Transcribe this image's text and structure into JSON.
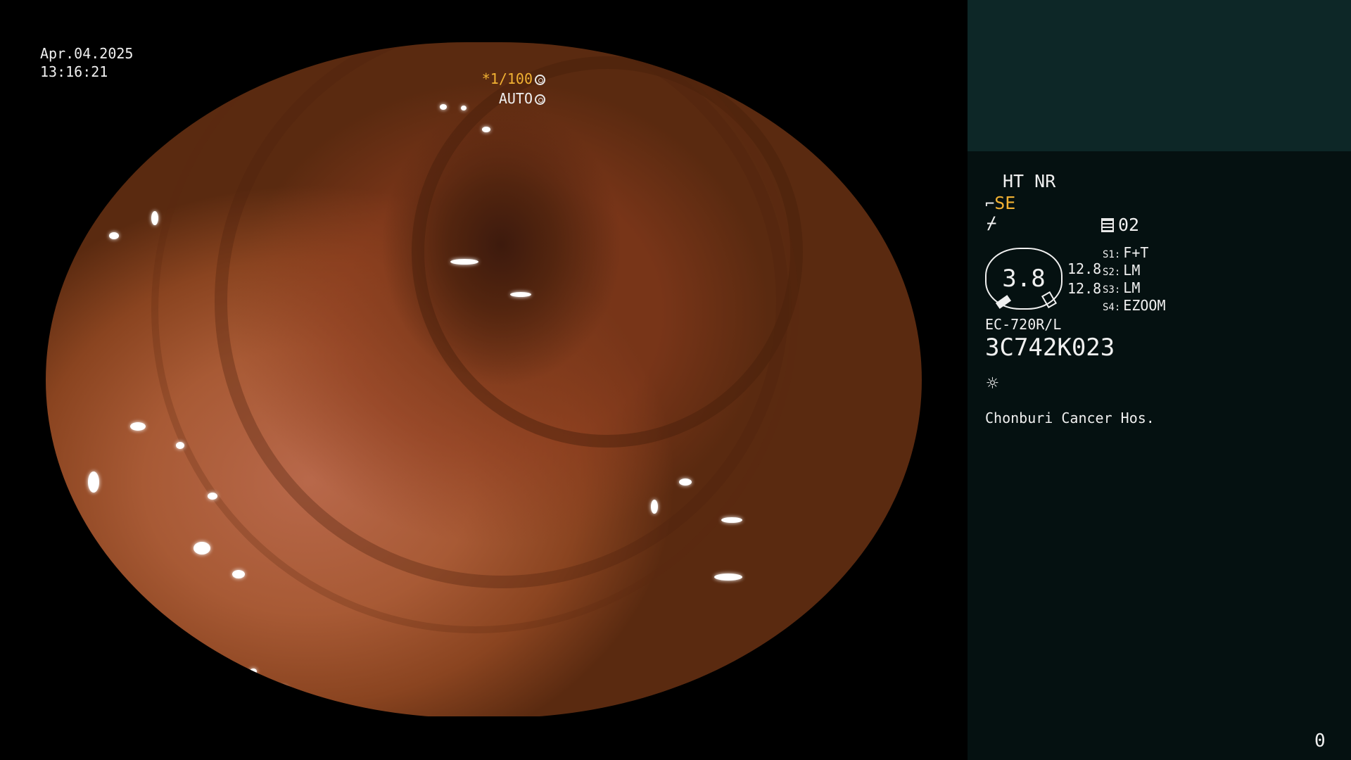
{
  "overlay": {
    "date": "Apr.04.2025",
    "time": "13:16:21",
    "shutter": "*1/100",
    "mode": "AUTO"
  },
  "panel": {
    "ht_nr": "HT NR",
    "enhance": "SE",
    "memory": "02",
    "magnification": "3.8",
    "value_a": "12.8",
    "value_b": "12.8",
    "switches": [
      {
        "label": "S1:",
        "value": "F+T"
      },
      {
        "label": "S2:",
        "value": "LM"
      },
      {
        "label": "S3:",
        "value": "LM"
      },
      {
        "label": "S4:",
        "value": "EZOOM"
      }
    ],
    "scope_model": "EC-720R/L",
    "serial": "3C742K023",
    "hospital": "Chonburi Cancer Hos.",
    "counter": "0"
  },
  "colors": {
    "accent": "#f2b233",
    "panel_bg": "#051111",
    "panel_header": "#0d2727"
  },
  "icons": [
    "shutter-icon",
    "auto-icon",
    "scope-enhance-icon",
    "light-off-icon",
    "memory-icon",
    "light-source-icon"
  ]
}
